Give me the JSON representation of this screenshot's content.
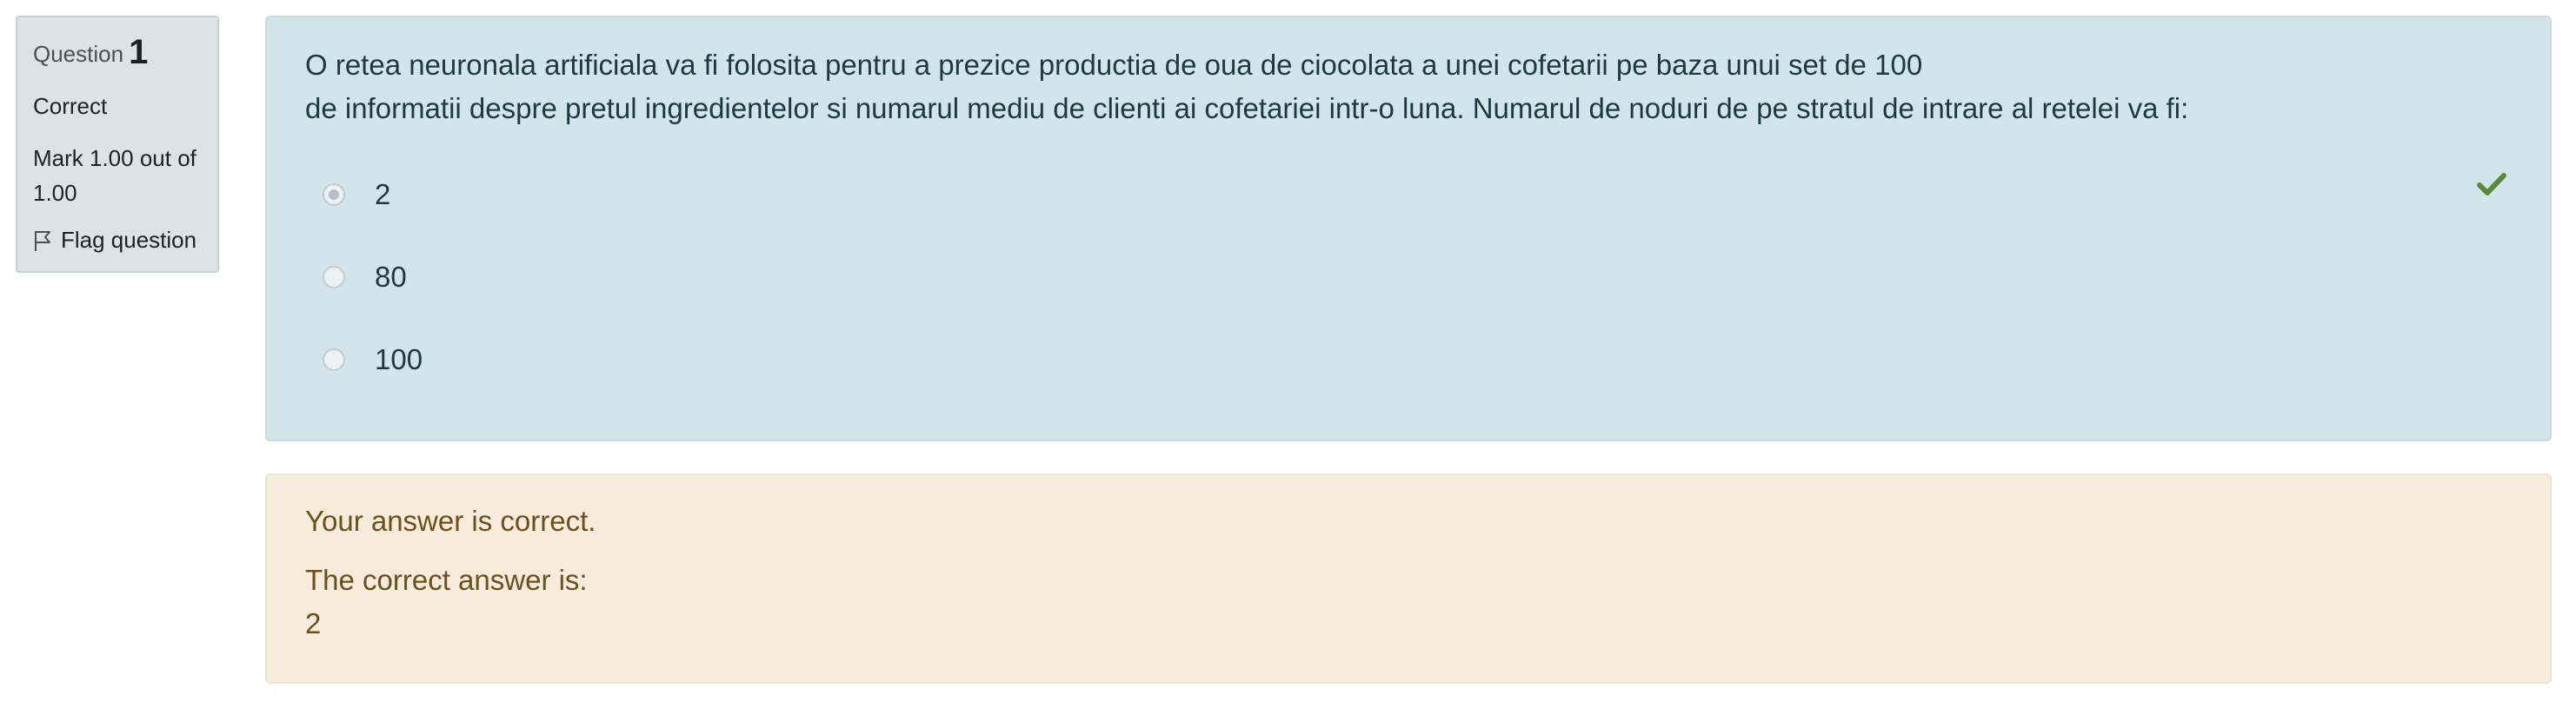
{
  "info": {
    "question_label": "Question",
    "question_number": "1",
    "state": "Correct",
    "grade": "Mark 1.00 out of 1.00",
    "flag_label": "Flag question",
    "flag_icon": "flag-icon"
  },
  "question": {
    "text_line1": "O retea neuronala artificiala va fi folosita pentru a prezice productia de oua de ciocolata a unei cofetarii pe baza unui set de 100",
    "text_line2": "de informatii despre pretul ingredientelor si numarul mediu de clienti ai cofetariei intr-o luna. Numarul de noduri de pe stratul de intrare al retelei va fi:",
    "options": [
      {
        "label": "2",
        "selected": true
      },
      {
        "label": "80",
        "selected": false
      },
      {
        "label": "100",
        "selected": false
      }
    ],
    "correct_icon": "checkmark-icon"
  },
  "outcome": {
    "feedback": "Your answer is correct.",
    "correct_answer_label": "The correct answer is:",
    "correct_answer_value": "2"
  },
  "colors": {
    "formulation_bg": "#d2e5ea",
    "outcome_bg": "#f7ecdb",
    "info_bg": "#dee2e6",
    "check_green": "#5a8a3a"
  }
}
